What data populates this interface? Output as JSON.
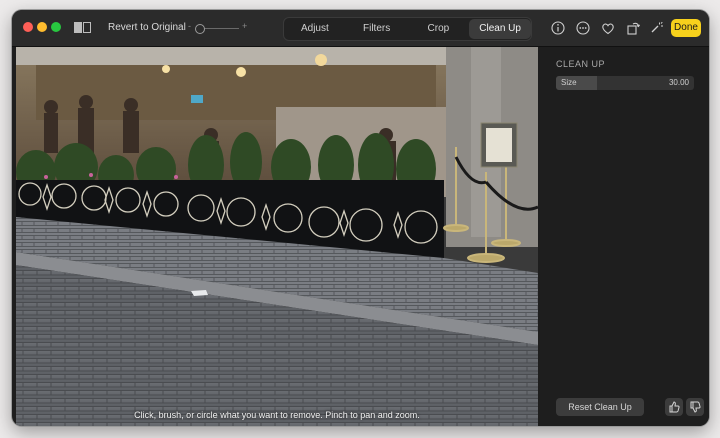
{
  "toolbar": {
    "revert_label": "Revert to Original",
    "slider_minus": "-",
    "slider_plus": "+",
    "tabs": [
      {
        "label": "Adjust",
        "active": false
      },
      {
        "label": "Filters",
        "active": false
      },
      {
        "label": "Crop",
        "active": false
      },
      {
        "label": "Clean Up",
        "active": true
      }
    ],
    "icons": [
      "info-icon",
      "more-icon",
      "heart-icon",
      "rotate-icon",
      "magic-wand-icon"
    ],
    "done_label": "Done",
    "accent_color": "#f7d11c"
  },
  "photo": {
    "hint": "Click, brush, or circle what you want to remove. Pinch to pan and zoom."
  },
  "panel": {
    "title": "CLEAN UP",
    "size_label": "Size",
    "size_value": "30.00",
    "size_fraction": 0.3,
    "reset_label": "Reset Clean Up"
  }
}
